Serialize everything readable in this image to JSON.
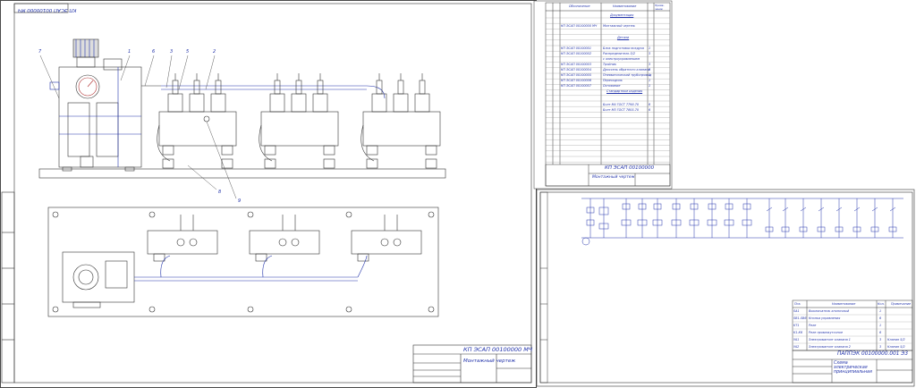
{
  "sheet_left": {
    "stamp_top": "КП ЭСАП 00100000 МЧ",
    "title_code": "КП ЭСАП 00100000 МЧ",
    "title_name": "Монтажный чертеж",
    "callouts": [
      "7",
      "1",
      "6",
      "3",
      "5",
      "2",
      "8",
      "9"
    ]
  },
  "sheet_spec": {
    "header": [
      "Обозначение",
      "Наименование",
      "Приме-чание"
    ],
    "sections": {
      "docs": "Документация",
      "parts": "Детали",
      "std": "Стандартные изделия"
    },
    "rows": [
      {
        "code": "КП ЭСАП 00100000 МЧ",
        "name": "Монтажный чертеж",
        "qty": ""
      },
      {
        "code": "КП ЭСАП 00100001",
        "name": "Блок подготовки воздуха",
        "qty": "1"
      },
      {
        "code": "КП ЭСАП 00100002",
        "name": "Распределитель 5/2",
        "qty": "3"
      },
      {
        "code": "",
        "name": "с электроуправлением",
        "qty": ""
      },
      {
        "code": "КП ЭСАП 00100003",
        "name": "Тройник",
        "qty": "3"
      },
      {
        "code": "КП ЭСАП 00100004",
        "name": "Дроссель обратного клапана",
        "qty": "6"
      },
      {
        "code": "КП ЭСАП 00100005",
        "name": "Пневматический трубопровод",
        "qty": "1"
      },
      {
        "code": "КП ЭСАП 00100006",
        "name": "Переходник",
        "qty": "1"
      },
      {
        "code": "КП ЭСАП 00100007",
        "name": "Основание",
        "qty": "1"
      },
      {
        "code": "",
        "name": "Болт М4 ГОСТ 7798-70",
        "qty": "6"
      },
      {
        "code": "",
        "name": "Болт М3 ГОСТ 7805-70",
        "qty": "6"
      }
    ],
    "title_code": "КП ЭСАП 00100000",
    "title_name": "Монтажный чертеж"
  },
  "sheet_right": {
    "title_code": "ПАППЭК 00100000.001 Э3",
    "title_name": "Схема электрическая принципиальная",
    "legend_header": [
      "Поз.",
      "Наименование",
      "Кол.",
      "Примечание"
    ],
    "legend_rows": [
      {
        "pos": "SA1",
        "name": "Выключатель кнопочный",
        "qty": "1",
        "note": ""
      },
      {
        "pos": "SB1-SB6",
        "name": "Кнопка управления",
        "qty": "6",
        "note": ""
      },
      {
        "pos": "KT1",
        "name": "Реле",
        "qty": "1",
        "note": ""
      },
      {
        "pos": "K1-K6",
        "name": "Реле промежуточное",
        "qty": "6",
        "note": ""
      },
      {
        "pos": "YA1",
        "name": "Электромагнит клапана 1",
        "qty": "3",
        "note": "Клапан 5/2"
      },
      {
        "pos": "YA2",
        "name": "Электромагнит клапана 2",
        "qty": "3",
        "note": "Клапан 5/2"
      }
    ]
  },
  "colors": {
    "line": "#2233aa",
    "frame": "#333333",
    "shade": "#e8e8e8"
  }
}
